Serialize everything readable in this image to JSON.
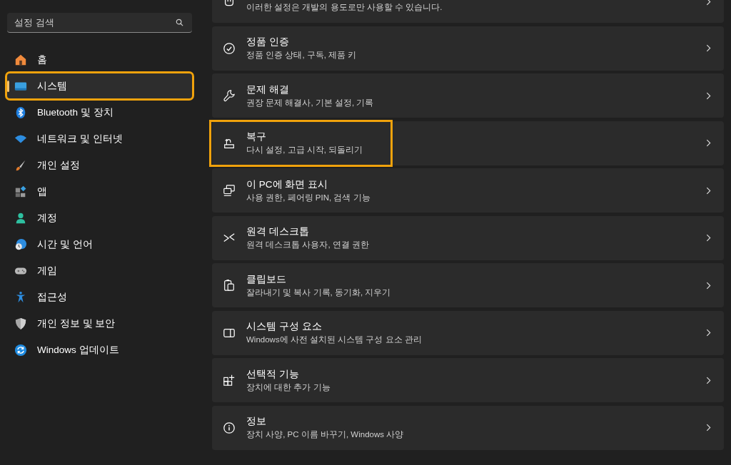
{
  "search": {
    "placeholder": "설정 검색"
  },
  "sidebar": {
    "items": [
      {
        "label": "홈",
        "selected": false,
        "highlighted": false
      },
      {
        "label": "시스템",
        "selected": true,
        "highlighted": true
      },
      {
        "label": "Bluetooth 및 장치",
        "selected": false,
        "highlighted": false
      },
      {
        "label": "네트워크 및 인터넷",
        "selected": false,
        "highlighted": false
      },
      {
        "label": "개인 설정",
        "selected": false,
        "highlighted": false
      },
      {
        "label": "앱",
        "selected": false,
        "highlighted": false
      },
      {
        "label": "계정",
        "selected": false,
        "highlighted": false
      },
      {
        "label": "시간 및 언어",
        "selected": false,
        "highlighted": false
      },
      {
        "label": "게임",
        "selected": false,
        "highlighted": false
      },
      {
        "label": "접근성",
        "selected": false,
        "highlighted": false
      },
      {
        "label": "개인 정보 및 보안",
        "selected": false,
        "highlighted": false
      },
      {
        "label": "Windows 업데이트",
        "selected": false,
        "highlighted": false
      }
    ]
  },
  "cards": [
    {
      "subtitle": "이러한 설정은 개발의 용도로만 사용할 수 있습니다.",
      "highlighted": false
    },
    {
      "title": "정품 인증",
      "subtitle": "정품 인증 상태, 구독, 제품 키",
      "highlighted": false
    },
    {
      "title": "문제 해결",
      "subtitle": "권장 문제 해결사, 기본 설정, 기록",
      "highlighted": false
    },
    {
      "title": "복구",
      "subtitle": "다시 설정, 고급 시작, 되돌리기",
      "highlighted": true
    },
    {
      "title": "이 PC에 화면 표시",
      "subtitle": "사용 권한, 페어링 PIN, 검색 기능",
      "highlighted": false
    },
    {
      "title": "원격 데스크톱",
      "subtitle": "원격 데스크톱 사용자, 연결 권한",
      "highlighted": false
    },
    {
      "title": "클립보드",
      "subtitle": "잘라내기 및 복사 기록, 동기화, 지우기",
      "highlighted": false
    },
    {
      "title": "시스템 구성 요소",
      "subtitle": "Windows에 사전 설치된 시스템 구성 요소 관리",
      "highlighted": false
    },
    {
      "title": "선택적 기능",
      "subtitle": "장치에 대한 추가 기능",
      "highlighted": false
    },
    {
      "title": "정보",
      "subtitle": "장치 사양, PC 이름 바꾸기, Windows 사양",
      "highlighted": false
    }
  ]
}
